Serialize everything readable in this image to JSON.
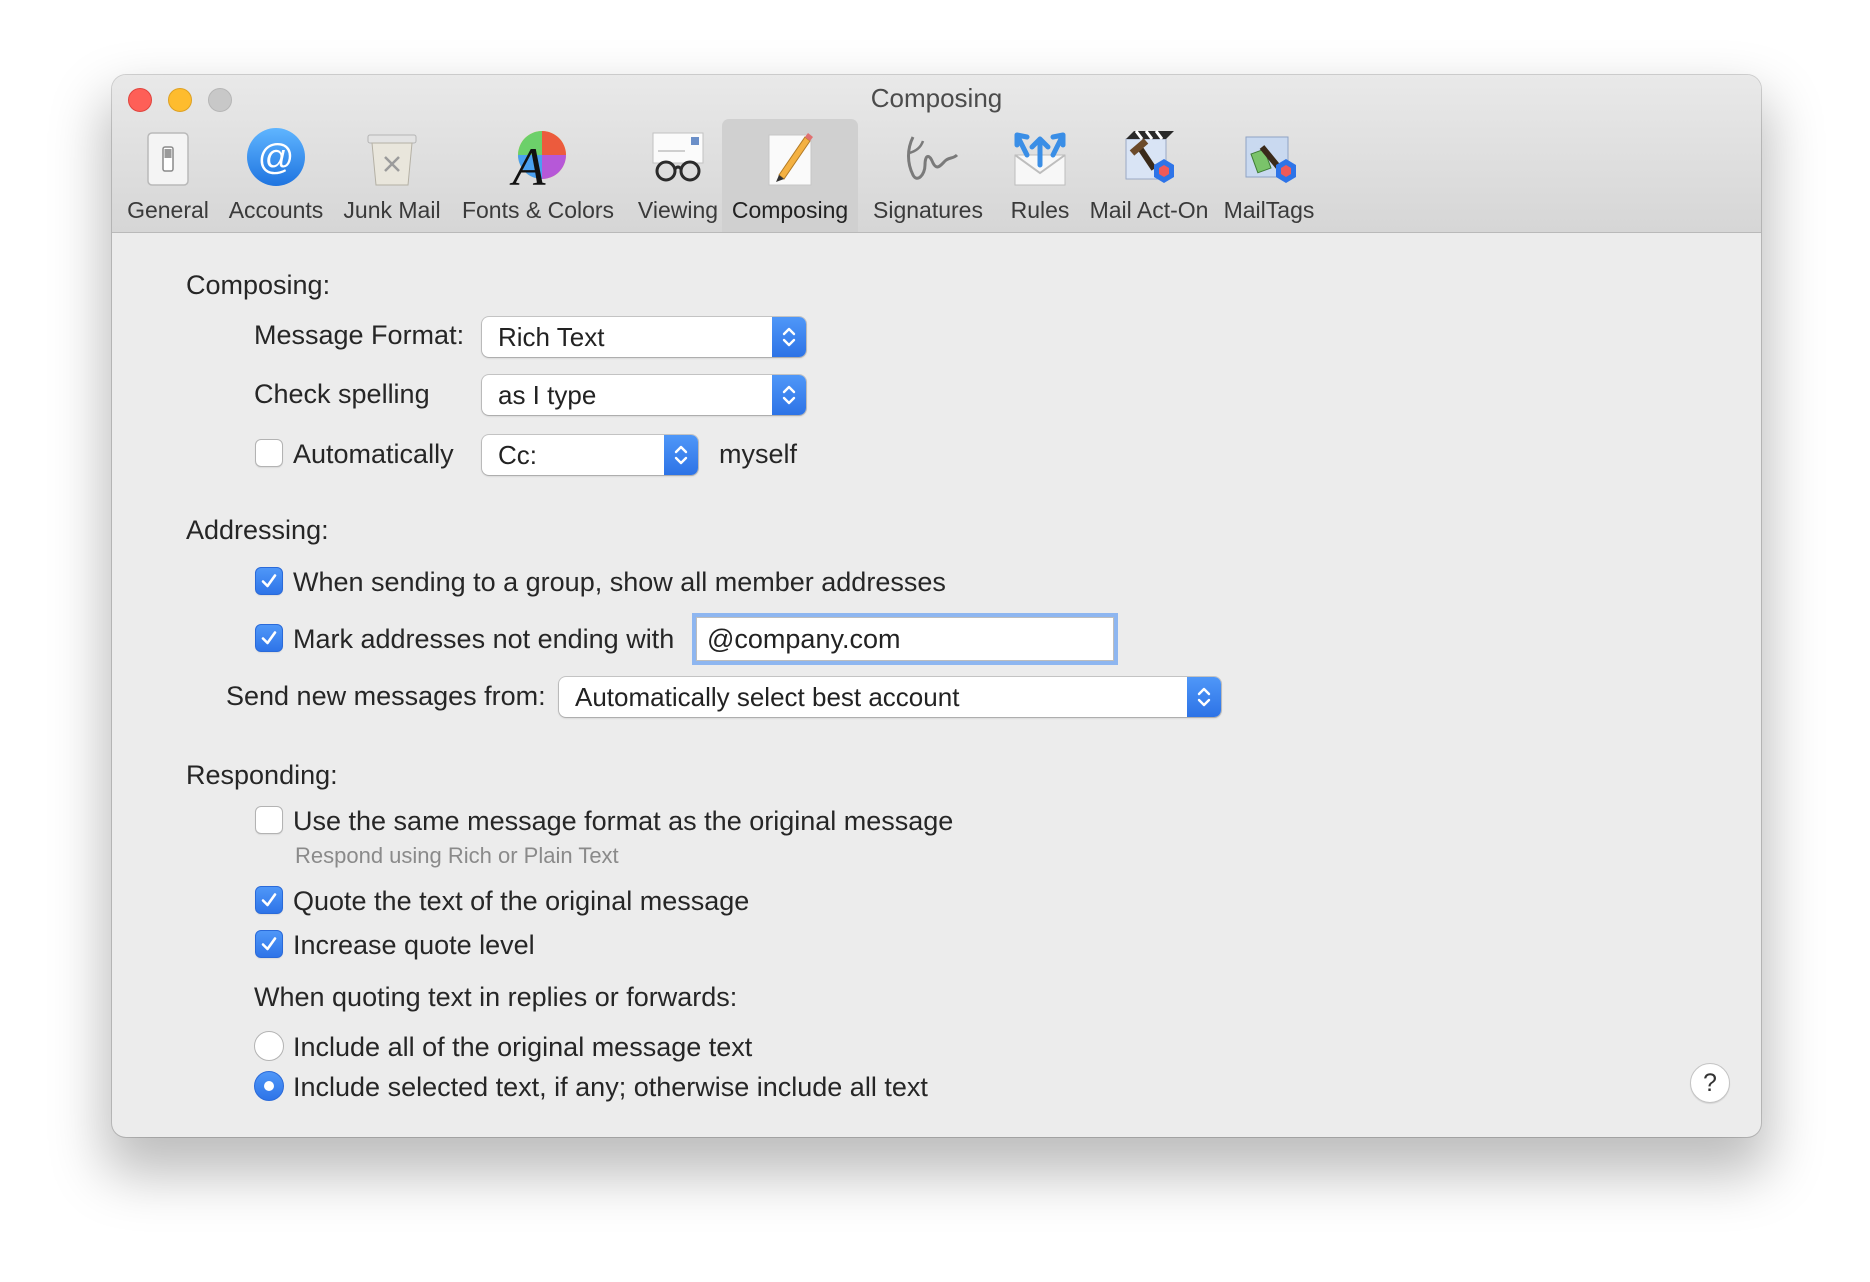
{
  "window": {
    "title": "Composing"
  },
  "toolbar": {
    "items": [
      {
        "label": "General",
        "icon": "general-switch-icon"
      },
      {
        "label": "Accounts",
        "icon": "at-sign-icon"
      },
      {
        "label": "Junk Mail",
        "icon": "junk-trash-icon"
      },
      {
        "label": "Fonts & Colors",
        "icon": "font-color-wheel-icon"
      },
      {
        "label": "Viewing",
        "icon": "glasses-icon"
      },
      {
        "label": "Composing",
        "icon": "pencil-paper-icon",
        "selected": true
      },
      {
        "label": "Signatures",
        "icon": "signature-icon"
      },
      {
        "label": "Rules",
        "icon": "rules-envelope-icon"
      },
      {
        "label": "Mail Act-On",
        "icon": "mail-act-on-icon"
      },
      {
        "label": "MailTags",
        "icon": "mailtags-icon"
      }
    ]
  },
  "composing": {
    "heading": "Composing:",
    "message_format_label": "Message Format:",
    "message_format_value": "Rich Text",
    "check_spelling_label": "Check spelling",
    "check_spelling_value": "as I type",
    "automatically_label": "Automatically",
    "automatically_checked": false,
    "cc_value": "Cc:",
    "myself_label": "myself"
  },
  "addressing": {
    "heading": "Addressing:",
    "group_label": "When sending to a group, show all member addresses",
    "group_checked": true,
    "mark_label": "Mark addresses not ending with",
    "mark_checked": true,
    "mark_domain": "@company.com",
    "send_from_label": "Send new messages from:",
    "send_from_value": "Automatically select best account"
  },
  "responding": {
    "heading": "Responding:",
    "same_format_label": "Use the same message format as the original message",
    "same_format_checked": false,
    "same_format_hint": "Respond using Rich or Plain Text",
    "quote_label": "Quote the text of the original message",
    "quote_checked": true,
    "increase_label": "Increase quote level",
    "increase_checked": true,
    "quoting_heading": "When quoting text in replies or forwards:",
    "include_all_label": "Include all of the original message text",
    "include_selected_label": "Include selected text, if any; otherwise include all text",
    "selected_option": "include_selected"
  },
  "help": {
    "label": "?"
  },
  "colors": {
    "accent": "#2e74e8",
    "close": "#fe5f57",
    "minimize": "#febc2e",
    "zoom": "#c8c8c8"
  }
}
